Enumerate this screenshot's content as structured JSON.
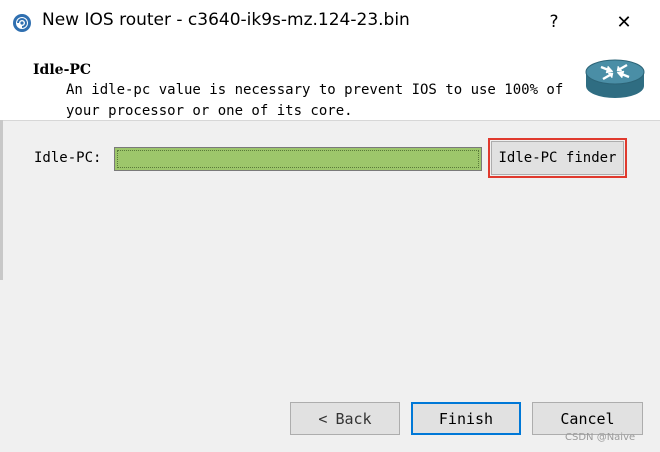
{
  "window": {
    "title": "New IOS router - c3640-ik9s-mz.124-23.bin",
    "help_glyph": "?",
    "close_glyph": "✕",
    "icon": "gns3-app-icon"
  },
  "header": {
    "title": "Idle-PC",
    "description": "An idle-pc value is necessary to prevent IOS to use 100% of your processor or one of its core.",
    "icon": "router-icon"
  },
  "form": {
    "idle_pc_label": "Idle-PC:",
    "idle_pc_value": "",
    "finder_button_label": "Idle-PC finder"
  },
  "buttons": {
    "back_chevron": "<",
    "back_label": "Back",
    "finish_label": "Finish",
    "cancel_label": "Cancel"
  },
  "watermark": "CSDN @Naive",
  "colors": {
    "input_fill": "#9dc66b",
    "highlight_border": "#e03a2e",
    "router_icon_blue": "#3f7f94",
    "default_button_border": "#0078d7"
  }
}
